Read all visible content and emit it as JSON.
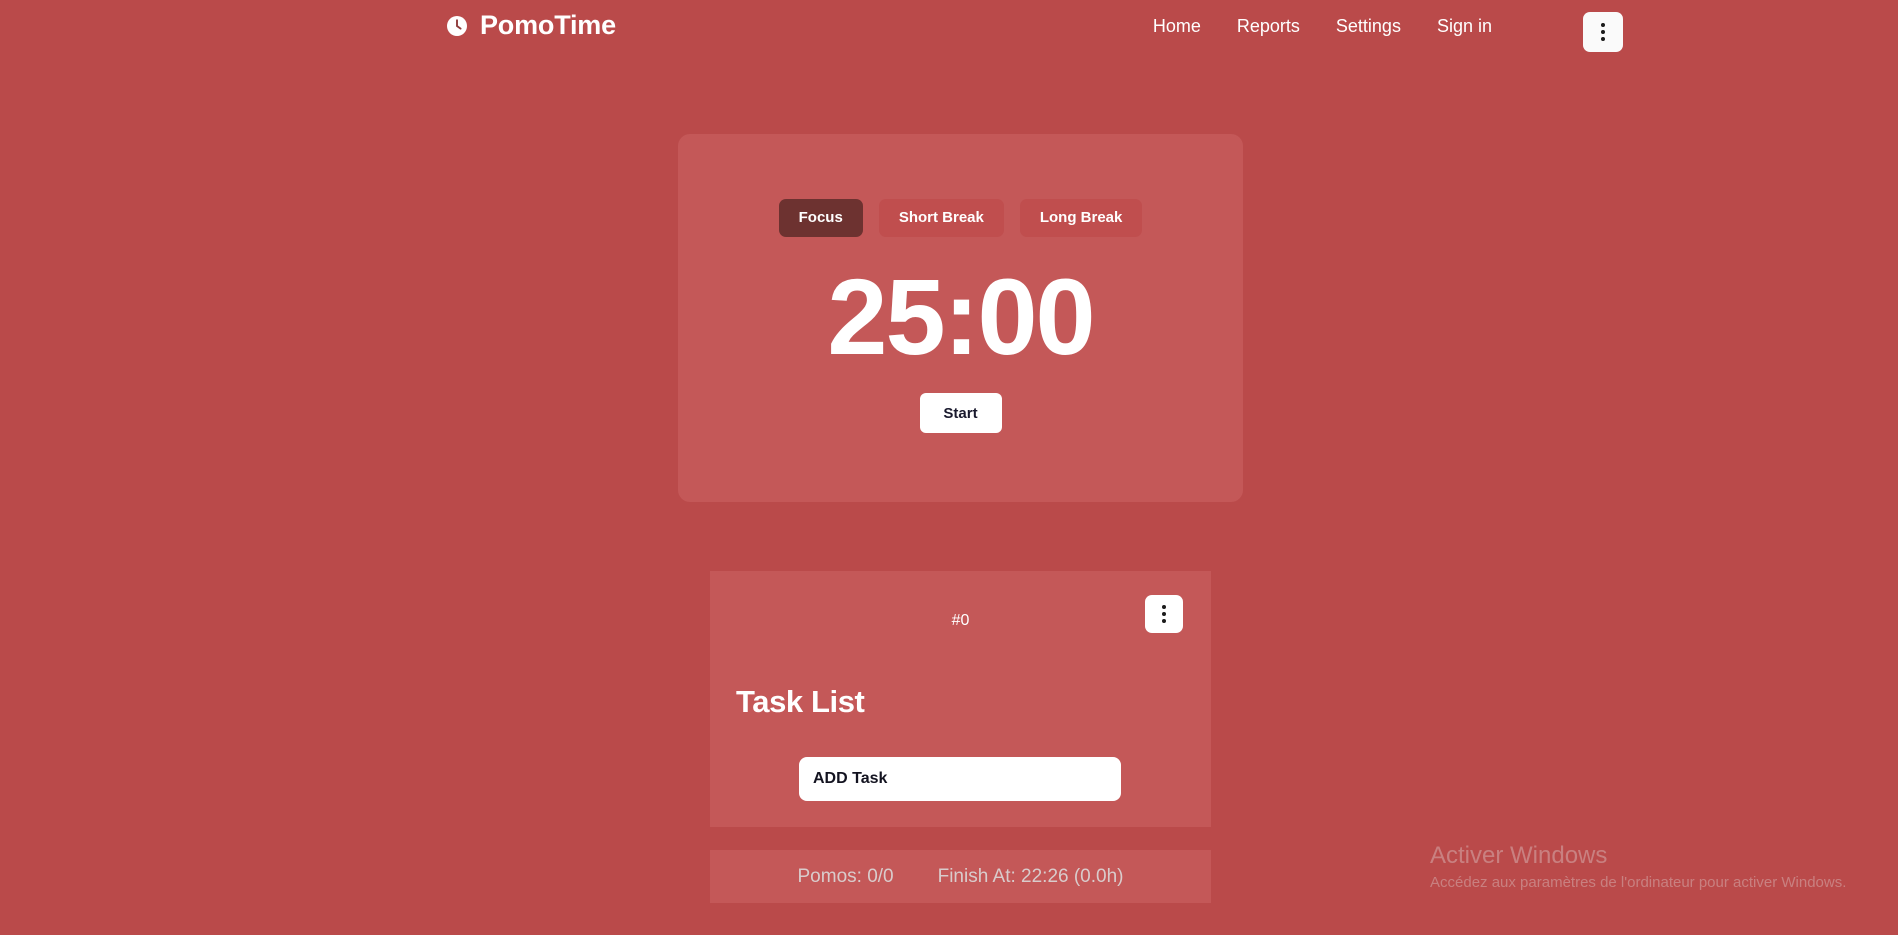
{
  "theme": {
    "page_bg": "#ba4a4a",
    "card_bg": "#c45858",
    "active_tab_bg": "#6d3230",
    "accent_white": "#ffffff",
    "status_text": "#d9cccc",
    "watermark_text": "#c98080"
  },
  "header": {
    "brand_name": "PomoTime",
    "brand_icon": "clock-icon",
    "nav_links": [
      {
        "label": "Home"
      },
      {
        "label": "Reports"
      },
      {
        "label": "Settings"
      },
      {
        "label": "Sign in"
      }
    ],
    "menu_icon": "kebab-menu-icon"
  },
  "timer": {
    "modes": [
      {
        "label": "Focus",
        "active": true
      },
      {
        "label": "Short Break",
        "active": false
      },
      {
        "label": "Long Break",
        "active": false
      }
    ],
    "display": "25:00",
    "start_label": "Start"
  },
  "tasks": {
    "counter": "#0",
    "menu_icon": "kebab-menu-icon",
    "title": "Task List",
    "add_task_value": "ADD Task",
    "add_task_placeholder": "ADD Task"
  },
  "status": {
    "pomos": "Pomos: 0/0",
    "finish_at": "Finish At: 22:26 (0.0h)"
  },
  "watermark": {
    "title": "Activer Windows",
    "subtitle": "Accédez aux paramètres de l'ordinateur pour activer Windows."
  }
}
